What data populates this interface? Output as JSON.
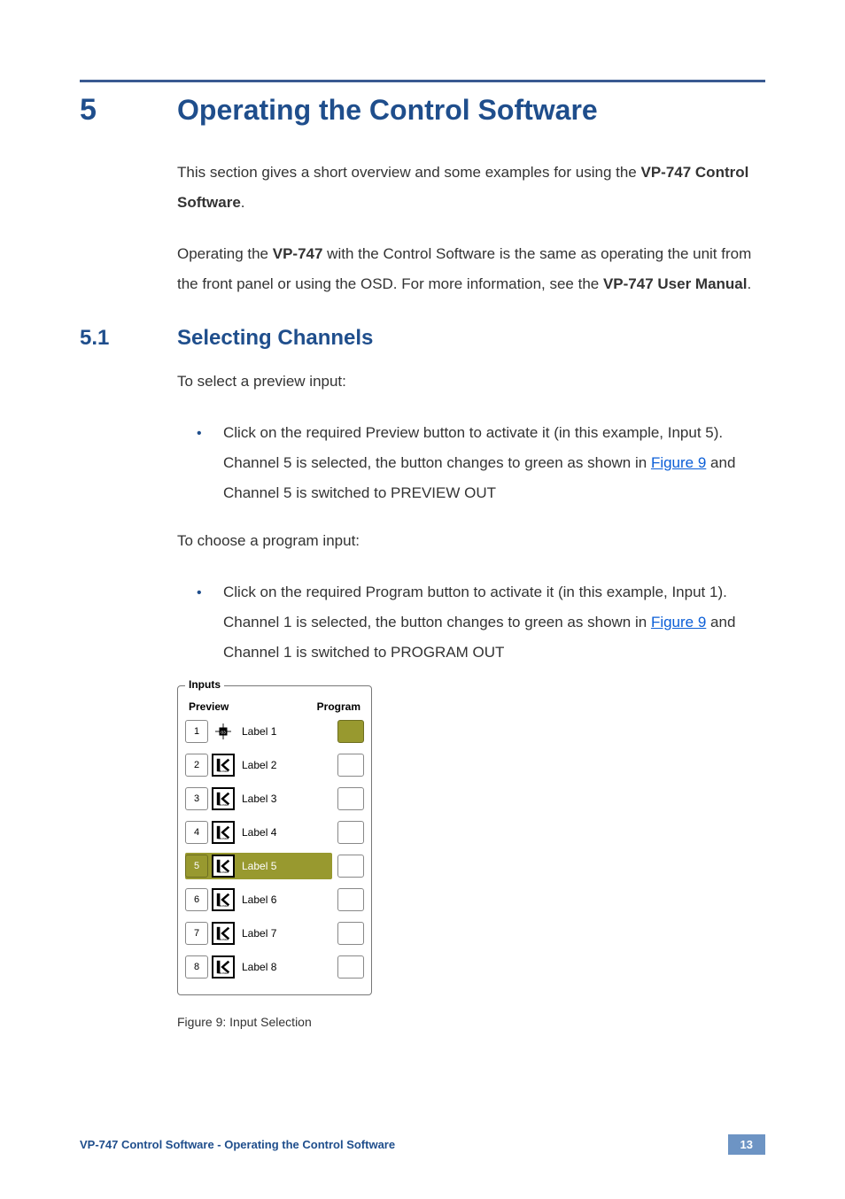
{
  "heading": {
    "num": "5",
    "title": "Operating the Control Software"
  },
  "intro": {
    "part1": "This section gives a short overview and some examples for using the ",
    "bold1": "VP-747 Control Software",
    "part2": "."
  },
  "para2": {
    "p1": "Operating the ",
    "b1": "VP-747",
    "p2": " with the Control Software is the same as operating the unit from the front panel or using the OSD. For more information, see the ",
    "b2": "VP-747 User Manual",
    "p3": "."
  },
  "sub": {
    "num": "5.1",
    "title": "Selecting Channels"
  },
  "sel_preview_intro": "To select a preview input:",
  "bullet1": {
    "p1": "Click on the required Preview button to activate it (in this example, Input 5). Channel 5 is selected, the button changes to green as shown in ",
    "link": "Figure 9",
    "p2": " and Channel 5 is switched to PREVIEW OUT"
  },
  "sel_program_intro": "To choose a program input:",
  "bullet2": {
    "p1": "Click on the required Program button to activate it (in this example, Input 1). Channel 1 is selected, the button changes to green as shown in ",
    "link": "Figure 9",
    "p2": " and Channel 1 is switched to PROGRAM OUT"
  },
  "panel": {
    "legend": "Inputs",
    "headerPreview": "Preview",
    "headerProgram": "Program",
    "rows": [
      {
        "num": "1",
        "label": "Label 1",
        "previewActive": false,
        "programActive": true,
        "iconType": "chip"
      },
      {
        "num": "2",
        "label": "Label 2",
        "previewActive": false,
        "programActive": false,
        "iconType": "k"
      },
      {
        "num": "3",
        "label": "Label 3",
        "previewActive": false,
        "programActive": false,
        "iconType": "k"
      },
      {
        "num": "4",
        "label": "Label 4",
        "previewActive": false,
        "programActive": false,
        "iconType": "k"
      },
      {
        "num": "5",
        "label": "Label 5",
        "previewActive": true,
        "programActive": false,
        "iconType": "k"
      },
      {
        "num": "6",
        "label": "Label 6",
        "previewActive": false,
        "programActive": false,
        "iconType": "k"
      },
      {
        "num": "7",
        "label": "Label 7",
        "previewActive": false,
        "programActive": false,
        "iconType": "k"
      },
      {
        "num": "8",
        "label": "Label 8",
        "previewActive": false,
        "programActive": false,
        "iconType": "k"
      }
    ]
  },
  "caption": "Figure 9: Input Selection",
  "footer": {
    "left": "VP-747 Control Software - Operating the Control Software",
    "page": "13"
  }
}
